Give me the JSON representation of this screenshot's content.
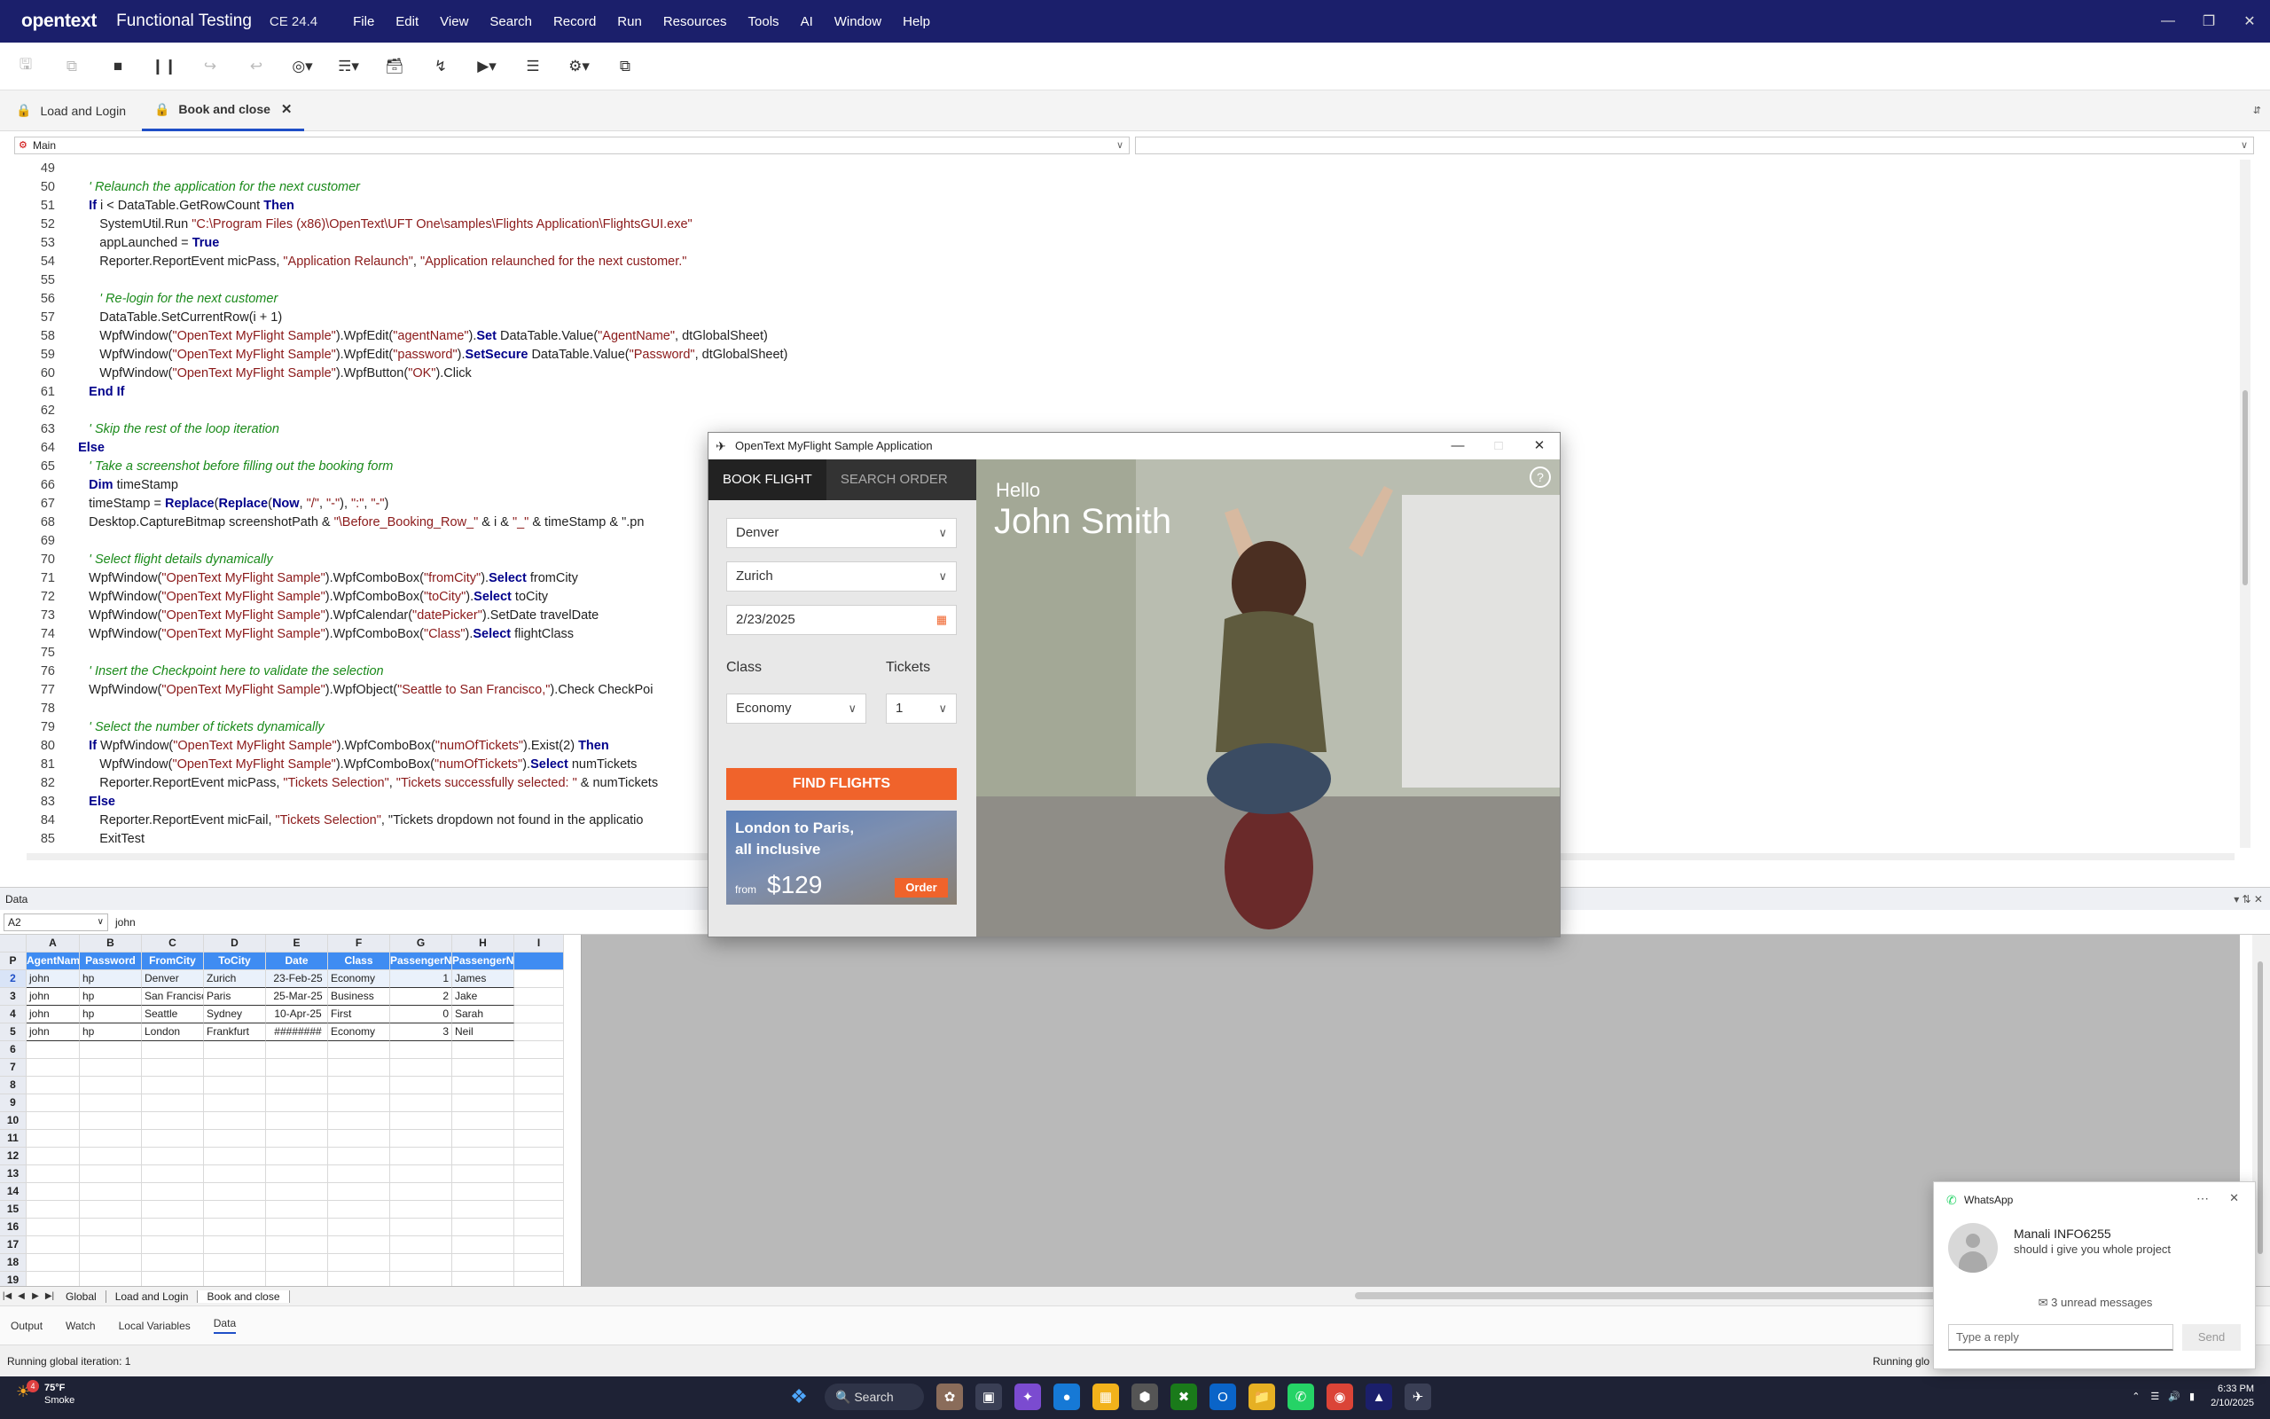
{
  "titlebar": {
    "brand": "opentext",
    "product": "Functional Testing",
    "version": "CE 24.4",
    "menu": [
      "File",
      "Edit",
      "View",
      "Search",
      "Record",
      "Run",
      "Resources",
      "Tools",
      "AI",
      "Window",
      "Help"
    ]
  },
  "tabs": [
    {
      "label": "Load and Login"
    },
    {
      "label": "Book and close",
      "active": true
    }
  ],
  "selectors": {
    "left": "Main",
    "right": ""
  },
  "code": [
    {
      "n": "49",
      "t": ""
    },
    {
      "n": "50",
      "t": "      ' Relaunch the application for the next customer",
      "cls": "cm"
    },
    {
      "n": "51",
      "t": "      If i < DataTable.GetRowCount Then"
    },
    {
      "n": "52",
      "t": "         SystemUtil.Run \"C:\\Program Files (x86)\\OpenText\\UFT One\\samples\\Flights Application\\FlightsGUI.exe\""
    },
    {
      "n": "53",
      "t": "         appLaunched = True"
    },
    {
      "n": "54",
      "t": "         Reporter.ReportEvent micPass, \"Application Relaunch\", \"Application relaunched for the next customer.\""
    },
    {
      "n": "55",
      "t": ""
    },
    {
      "n": "56",
      "t": "         ' Re-login for the next customer",
      "cls": "cm"
    },
    {
      "n": "57",
      "t": "         DataTable.SetCurrentRow(i + 1)"
    },
    {
      "n": "58",
      "t": "         WpfWindow(\"OpenText MyFlight Sample\").WpfEdit(\"agentName\").Set DataTable.Value(\"AgentName\", dtGlobalSheet)"
    },
    {
      "n": "59",
      "t": "         WpfWindow(\"OpenText MyFlight Sample\").WpfEdit(\"password\").SetSecure DataTable.Value(\"Password\", dtGlobalSheet)"
    },
    {
      "n": "60",
      "t": "         WpfWindow(\"OpenText MyFlight Sample\").WpfButton(\"OK\").Click"
    },
    {
      "n": "61",
      "t": "      End If"
    },
    {
      "n": "62",
      "t": ""
    },
    {
      "n": "63",
      "t": "      ' Skip the rest of the loop iteration",
      "cls": "cm"
    },
    {
      "n": "64",
      "t": "   Else"
    },
    {
      "n": "65",
      "t": "      ' Take a screenshot before filling out the booking form",
      "cls": "cm"
    },
    {
      "n": "66",
      "t": "      Dim timeStamp"
    },
    {
      "n": "67",
      "t": "      timeStamp = Replace(Replace(Now, \"/\", \"-\"), \":\", \"-\")"
    },
    {
      "n": "68",
      "t": "      Desktop.CaptureBitmap screenshotPath & \"\\Before_Booking_Row_\" & i & \"_\" & timeStamp & \".pn"
    },
    {
      "n": "69",
      "t": ""
    },
    {
      "n": "70",
      "t": "      ' Select flight details dynamically",
      "cls": "cm"
    },
    {
      "n": "71",
      "t": "      WpfWindow(\"OpenText MyFlight Sample\").WpfComboBox(\"fromCity\").Select fromCity"
    },
    {
      "n": "72",
      "t": "      WpfWindow(\"OpenText MyFlight Sample\").WpfComboBox(\"toCity\").Select toCity"
    },
    {
      "n": "73",
      "t": "      WpfWindow(\"OpenText MyFlight Sample\").WpfCalendar(\"datePicker\").SetDate travelDate"
    },
    {
      "n": "74",
      "t": "      WpfWindow(\"OpenText MyFlight Sample\").WpfComboBox(\"Class\").Select flightClass"
    },
    {
      "n": "75",
      "t": ""
    },
    {
      "n": "76",
      "t": "      ' Insert the Checkpoint here to validate the selection",
      "cls": "cm"
    },
    {
      "n": "77",
      "t": "      WpfWindow(\"OpenText MyFlight Sample\").WpfObject(\"Seattle to San Francisco,\").Check CheckPoi"
    },
    {
      "n": "78",
      "t": ""
    },
    {
      "n": "79",
      "t": "      ' Select the number of tickets dynamically",
      "cls": "cm"
    },
    {
      "n": "80",
      "t": "      If WpfWindow(\"OpenText MyFlight Sample\").WpfComboBox(\"numOfTickets\").Exist(2) Then"
    },
    {
      "n": "81",
      "t": "         WpfWindow(\"OpenText MyFlight Sample\").WpfComboBox(\"numOfTickets\").Select numTickets"
    },
    {
      "n": "82",
      "t": "         Reporter.ReportEvent micPass, \"Tickets Selection\", \"Tickets successfully selected: \" & numTickets"
    },
    {
      "n": "83",
      "t": "      Else"
    },
    {
      "n": "84",
      "t": "         Reporter.ReportEvent micFail, \"Tickets Selection\", \"Tickets dropdown not found in the applicatio"
    },
    {
      "n": "85",
      "t": "         ExitTest"
    }
  ],
  "data_panel": {
    "title": "Data",
    "cell_ref": "A2",
    "cell_value": "john",
    "col_letters": [
      "A",
      "B",
      "C",
      "D",
      "E",
      "F",
      "G",
      "H",
      "I"
    ],
    "headers": [
      "AgentName",
      "Password",
      "FromCity",
      "ToCity",
      "Date",
      "Class",
      "PassengerNum",
      "PassengerName"
    ],
    "rows": [
      [
        "john",
        "hp",
        "Denver",
        "Zurich",
        "23-Feb-25",
        "Economy",
        "1",
        "James"
      ],
      [
        "john",
        "hp",
        "San Francisco",
        "Paris",
        "25-Mar-25",
        "Business",
        "2",
        "Jake"
      ],
      [
        "john",
        "hp",
        "Seattle",
        "Sydney",
        "10-Apr-25",
        "First",
        "0",
        "Sarah"
      ],
      [
        "john",
        "hp",
        "London",
        "Frankfurt",
        "########",
        "Economy",
        "3",
        "Neil"
      ]
    ],
    "row_numbers": [
      "P",
      "2",
      "3",
      "4",
      "5",
      "6",
      "7",
      "8",
      "9",
      "10",
      "11",
      "12",
      "13",
      "14",
      "15",
      "16",
      "17",
      "18",
      "19"
    ],
    "sheet_tabs": [
      "Global",
      "Load and Login",
      "Book and close"
    ]
  },
  "bottom_tabs": [
    "Output",
    "Watch",
    "Local Variables",
    "Data"
  ],
  "status": {
    "left": "Running global iteration: 1",
    "right": "Running glo"
  },
  "flight_app": {
    "title": "OpenText MyFlight Sample Application",
    "tab_book": "BOOK FLIGHT",
    "tab_search": "SEARCH ORDER",
    "from": "Denver",
    "to": "Zurich",
    "date": "2/23/2025",
    "class_label": "Class",
    "class_value": "Economy",
    "tickets_label": "Tickets",
    "tickets_value": "1",
    "find_button": "FIND FLIGHTS",
    "ad_line1": "London to Paris,",
    "ad_line2": "all inclusive",
    "ad_from": "from",
    "ad_price": "$129",
    "ad_order": "Order",
    "hello": "Hello",
    "user": "John Smith"
  },
  "whatsapp": {
    "app": "WhatsApp",
    "sender": "Manali INFO6255",
    "message": "should i give you whole project",
    "unread": "3 unread messages",
    "reply_placeholder": "Type a reply",
    "send": "Send"
  },
  "taskbar": {
    "temp": "75°F",
    "weather": "Smoke",
    "search": "Search",
    "time": "6:33 PM",
    "date": "2/10/2025",
    "badge": "4"
  }
}
